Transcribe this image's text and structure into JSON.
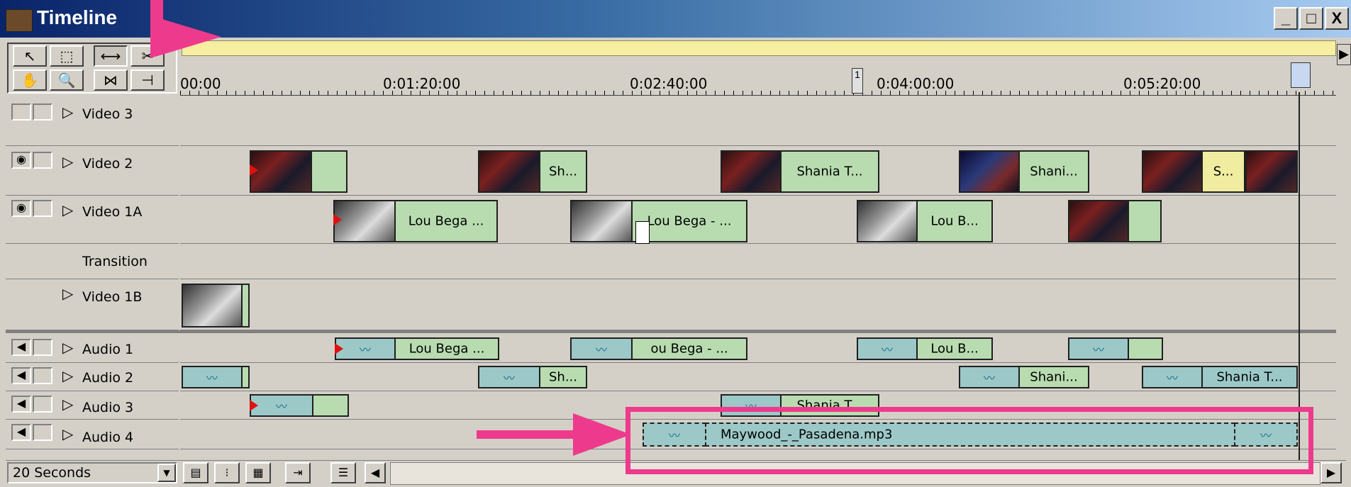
{
  "window": {
    "title": "Timeline",
    "controls": [
      "_",
      "□",
      "X"
    ]
  },
  "ruler": {
    "ticks": [
      "00:00",
      "0:01:20:00",
      "0:02:40:00",
      "0:04:00:00",
      "0:05:20:00"
    ],
    "marker": "1"
  },
  "tracks": {
    "video3": "Video 3",
    "video2": "Video 2",
    "video1a": "Video 1A",
    "transition": "Transition",
    "video1b": "Video 1B",
    "audio1": "Audio 1",
    "audio2": "Audio 2",
    "audio3": "Audio 3",
    "audio4": "Audio 4"
  },
  "clips": {
    "v2_sh": "Sh...",
    "v2_shania_t": "Shania T...",
    "v2_shani": "Shani...",
    "v2_s": "S...",
    "v1a_lou1": "Lou Bega ...",
    "v1a_lou2": "Lou Bega - ...",
    "v1a_lou3": "Lou B...",
    "a1_lou1": "Lou Bega ...",
    "a1_lou2": "ou Bega - ...",
    "a1_lou3": "Lou B...",
    "a2_sh": "Sh...",
    "a2_shani": "Shani...",
    "a2_shania_t": "Shania T...",
    "a3_shania_t": "Shania T...",
    "a4_file": "Maywood_-_Pasadena.mp3"
  },
  "bottom": {
    "zoom": "20 Seconds"
  },
  "icons": {
    "wave": "waveform-icon",
    "eye": "eye-icon",
    "speaker": "speaker-icon"
  },
  "colors": {
    "annotation": "#ee3a8c",
    "video_clip": "#b8dcb0",
    "audio_clip": "#9cc8c8"
  }
}
